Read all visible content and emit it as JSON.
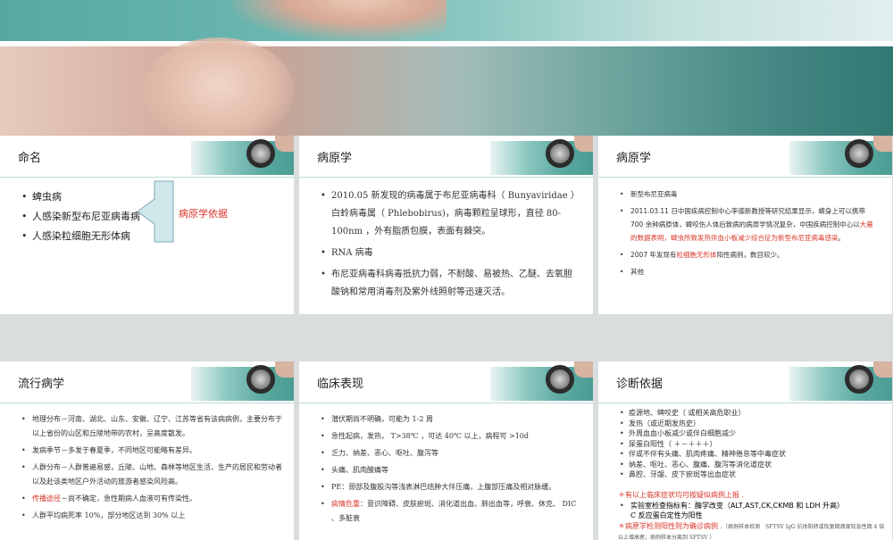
{
  "slides": [
    {
      "title": "命名",
      "items": [
        "蜱虫病",
        "人感染新型布尼亚病毒病",
        "人感染粒细胞无形体病"
      ],
      "note": "病原学依据"
    },
    {
      "title": "病原学",
      "items": [
        "2010.05 新发现的病毒属于布尼亚病毒科（ Bunyaviridae ）白蛉病毒属（ Phlebobirus)，病毒颗粒呈球形，直径 80-100nm ，外有脂质包膜，表面有棘突。",
        "RNA 病毒",
        "布尼亚病毒科病毒抵抗力弱，不耐酸、易被热、乙醚、去氧胆酸钠和常用消毒剂及紫外线照射等迅速灭活。"
      ]
    },
    {
      "title": "病原学",
      "item1": "新型布尼亚病毒",
      "item2_normal": "2011.03.11 日中国疾病控制中心李德新教授等研究结果显示，蜱身上可以携带 700 余种病原体，蜱咬伤人体后致病的病原学情况复杂，中国疾病控制中心以",
      "item2_red": "大量的数据表明，蜱虫所致发热伴血小板减少综合征为新型布尼亚病毒感染",
      "item2_end": "。",
      "item3_pre": "2007 年发现有",
      "item3_red": "粒细胞无形体",
      "item3_post": "阳性病例，数目较少。",
      "item4": "其他"
    },
    {
      "title": "流行病学",
      "items": [
        "地理分布－河南、湖北、山东、安徽、辽宁、江苏等省有该病病例，主要分布于以上省份的山区和丘陵地带的农村，呈高度散发。",
        "发病季节－多发于春夏季，不同地区可能略有差异。",
        "人群分布－人群普遍易感，丘陵、山地、森林等地区生活、生产的居民和劳动者以及赴该类地区户外活动的旅游者感染风险高。"
      ],
      "red_label": "传播途径",
      "red_rest": "－尚不确定，急性期病人血液可有传染性。",
      "last": "人群平均病死率 10%，部分地区达到 30% 以上"
    },
    {
      "title": "临床表现",
      "items": [
        "潜伏期尚不明确，可能为 1-2 周",
        "急性起病，发热， T>38℃ ，可达 40℃ 以上，病程可 >10d",
        "乏力、纳差、恶心、呕吐、腹泻等",
        "头痛、肌肉酸痛等",
        "PE：颈部及腹股沟等浅表淋巴结肿大伴压痛，上腹部压痛及相对脉缓。"
      ],
      "red_label": "病情危重",
      "red_rest": "：意识障碍、皮肤瘀斑、消化道出血、肺出血等，呼衰、休克、 DIC 、多脏衰"
    },
    {
      "title": "诊断依据",
      "items": [
        "疫源地、蜱咬史（ 或相关高危职业）",
        "发热（或近期发热史）",
        "外周血血小板减少或伴白细胞减少",
        "尿蛋白阳性（ ＋－＋＋＋）",
        "伴或不伴有头痛、肌肉疼痛、精神倦怠等中毒症状",
        "纳差、呕吐、恶心、腹痛、腹泻等消化道症状",
        "鼻腔、牙龈、皮下瘀斑等出血症状"
      ],
      "red_line": "＊有以上临床症状均可按疑似病例上报 .",
      "lab_pre": "实验室检查指标有：酶学改变（",
      "lab_enz": "ALT,AST,CK,CKMB",
      "lab_and": " 和 ",
      "lab_ldh": "LDH",
      "lab_post": " 升高）",
      "crp": "C 反应蛋白定性为阳性",
      "confirm_red": "＊病原学检测阳性则为确诊病例 .",
      "confirm_tiny": "（病例样本检测　SFTSV IgG 抗体阳转或恢复期滴度较急性期 4 倍以上增高者；病例样本分离到 SFTSV ）"
    }
  ]
}
